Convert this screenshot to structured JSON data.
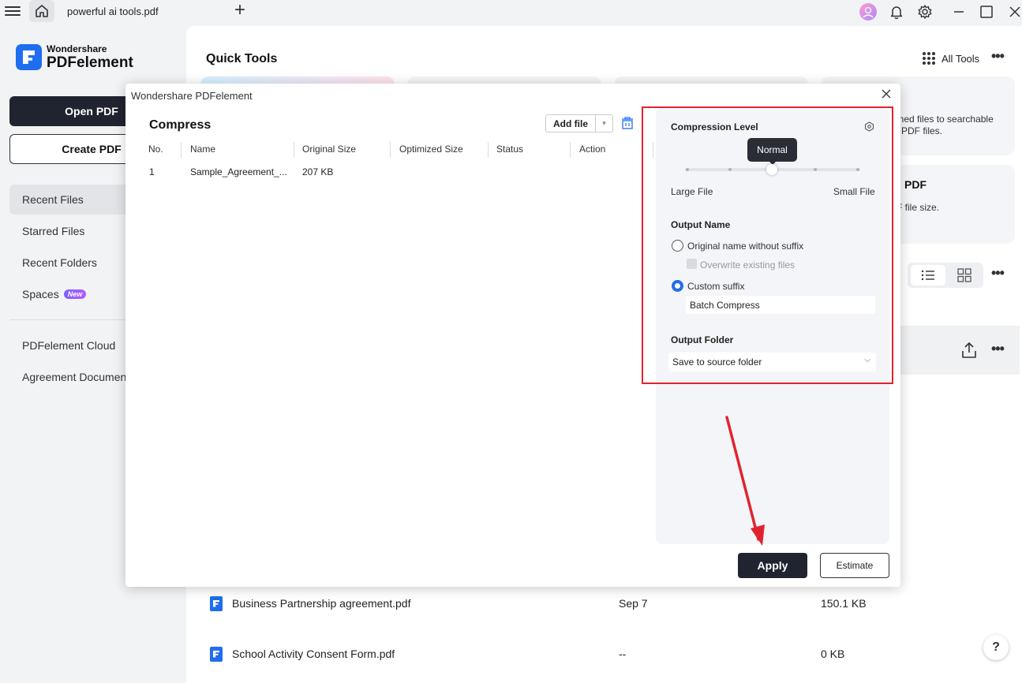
{
  "titlebar": {
    "tab_title": "powerful ai tools.pdf"
  },
  "sidebar": {
    "logo_top": "Wondershare",
    "logo_bottom": "PDFelement",
    "open_pdf": "Open PDF",
    "create_pdf": "Create PDF",
    "items": [
      {
        "label": "Recent Files"
      },
      {
        "label": "Starred Files"
      },
      {
        "label": "Recent Folders"
      },
      {
        "label": "Spaces",
        "badge": "New"
      },
      {
        "label": "PDFelement Cloud"
      },
      {
        "label": "Agreement Documen"
      }
    ]
  },
  "main": {
    "quick_tools_title": "Quick Tools",
    "all_tools": "All Tools",
    "card1_text_line1": "nned files to searchable",
    "card1_text_line2": "e PDF files.",
    "card2_title": "PDF",
    "card2_text": "F file size.",
    "files": [
      {
        "name": "Business Partnership agreement.pdf",
        "date": "Sep 7",
        "size": "150.1 KB"
      },
      {
        "name": "School Activity Consent Form.pdf",
        "date": "--",
        "size": "0 KB"
      }
    ],
    "help": "?"
  },
  "dialog": {
    "window_title": "Wondershare PDFelement",
    "title": "Compress",
    "add_file": "Add file",
    "columns": [
      "No.",
      "Name",
      "Original Size",
      "Optimized Size",
      "Status",
      "Action"
    ],
    "rows": [
      {
        "no": "1",
        "name": "Sample_Agreement_...",
        "original_size": "207 KB"
      }
    ],
    "settings": {
      "compression_level_label": "Compression Level",
      "level_tooltip": "Normal",
      "level_position": 0.5,
      "large_file": "Large File",
      "small_file": "Small File",
      "output_name_label": "Output Name",
      "option_original": "Original name without suffix",
      "option_overwrite": "Overwrite existing files",
      "option_custom": "Custom suffix",
      "custom_suffix_value": "Batch Compress",
      "output_folder_label": "Output Folder",
      "output_folder_value": "Save to source folder"
    },
    "apply": "Apply",
    "estimate": "Estimate"
  },
  "colors": {
    "accent": "#1f6df0",
    "dark_button": "#202330",
    "highlight_border": "#e0242f"
  }
}
